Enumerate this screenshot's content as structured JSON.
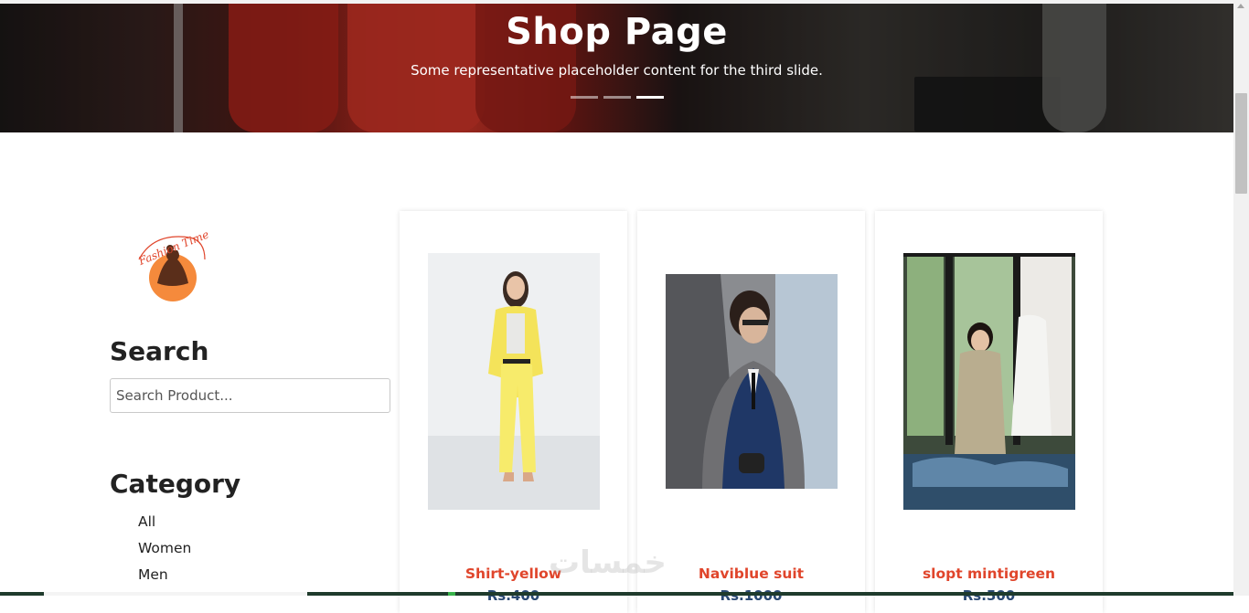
{
  "hero": {
    "title": "Shop Page",
    "subtitle": "Some representative placeholder content for the third slide.",
    "slides": 3,
    "active_slide": 3
  },
  "sidebar": {
    "logo_text": "Fashion Time",
    "search_title": "Search",
    "search_placeholder": "Search Product...",
    "category_title": "Category",
    "categories": [
      "All",
      "Women",
      "Men"
    ]
  },
  "products": [
    {
      "name": "Shirt-yellow",
      "price": "Rs.400"
    },
    {
      "name": "Naviblue suit",
      "price": "Rs.1000"
    },
    {
      "name": "slopt mintigreen",
      "price": "Rs.500"
    }
  ],
  "watermark": "خمسات",
  "colors": {
    "accent": "#e0452b",
    "price": "#2b4a74",
    "logo": "#f58a3c"
  }
}
